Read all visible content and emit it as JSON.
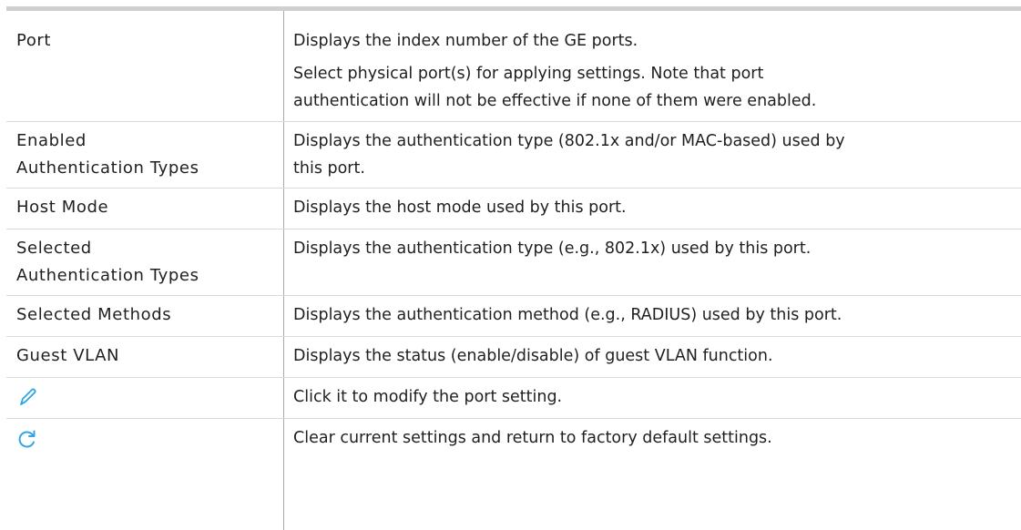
{
  "rows": [
    {
      "term": "Port",
      "desc": [
        "Displays the index number of the GE ports.",
        "Select physical port(s) for applying settings. Note that port",
        "authentication will not be effective if none of them were enabled."
      ]
    },
    {
      "term": [
        "Enabled",
        "Authentication Types"
      ],
      "desc": [
        "Displays the authentication type (802.1x and/or MAC-based) used by",
        "this port."
      ]
    },
    {
      "term": "Host Mode",
      "desc": [
        "Displays the host mode used by this port."
      ]
    },
    {
      "term": [
        "Selected",
        "Authentication Types"
      ],
      "desc": [
        "Displays the authentication type (e.g., 802.1x) used by this port."
      ]
    },
    {
      "term": "Selected Methods",
      "desc": [
        "Displays the authentication method (e.g., RADIUS) used by this port."
      ]
    },
    {
      "term": "Guest VLAN",
      "desc": [
        "Displays the status (enable/disable) of guest VLAN function."
      ]
    },
    {
      "term_icon": "edit-pencil-icon",
      "desc": [
        "Click it to modify the port setting."
      ]
    },
    {
      "term_icon": "refresh-icon",
      "desc": [
        "Clear current settings and return to factory default settings."
      ]
    }
  ],
  "colors": {
    "icon": "#2fa6e6",
    "top_rule": "#cfcfcf",
    "row_rule": "#d9d9d9",
    "column_rule": "#a8a8a8"
  }
}
